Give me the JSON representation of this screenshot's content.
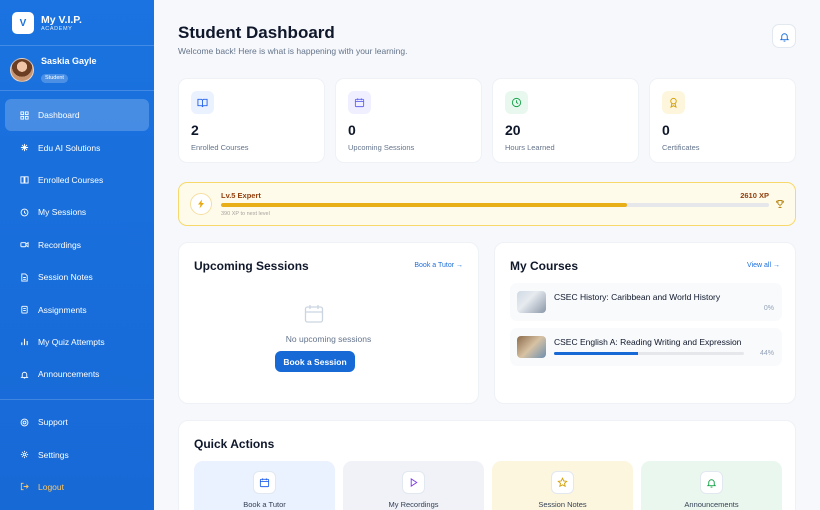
{
  "brand": {
    "logo_letter": "V",
    "name": "My V.I.P.",
    "sub": "ACADEMY"
  },
  "user": {
    "name": "Saskia Gayle",
    "role": "Student"
  },
  "nav": [
    {
      "label": "Dashboard",
      "icon": "grid-icon",
      "active": true
    },
    {
      "label": "Edu AI Solutions",
      "icon": "sparkle-icon"
    },
    {
      "label": "Enrolled Courses",
      "icon": "book-icon"
    },
    {
      "label": "My Sessions",
      "icon": "history-icon"
    },
    {
      "label": "Recordings",
      "icon": "video-icon"
    },
    {
      "label": "Session Notes",
      "icon": "file-icon"
    },
    {
      "label": "Assignments",
      "icon": "clipboard-icon"
    },
    {
      "label": "My Quiz Attempts",
      "icon": "bar-chart-icon"
    },
    {
      "label": "Announcements",
      "icon": "bell-icon"
    }
  ],
  "bottom_nav": [
    {
      "label": "Support",
      "icon": "lifebuoy-icon"
    },
    {
      "label": "Settings",
      "icon": "gear-icon"
    },
    {
      "label": "Logout",
      "icon": "logout-icon"
    }
  ],
  "header": {
    "title": "Student Dashboard",
    "subtitle": "Welcome back! Here is what is happening with your learning."
  },
  "stats": [
    {
      "value": "2",
      "label": "Enrolled Courses",
      "icon": "book-open-icon",
      "color": "#2563eb",
      "bg": "#eaf2ff"
    },
    {
      "value": "0",
      "label": "Upcoming Sessions",
      "icon": "calendar-icon",
      "color": "#6366f1",
      "bg": "#efefff"
    },
    {
      "value": "20",
      "label": "Hours Learned",
      "icon": "clock-icon",
      "color": "#16a34a",
      "bg": "#e8f8ee"
    },
    {
      "value": "0",
      "label": "Certificates",
      "icon": "award-icon",
      "color": "#d4a00a",
      "bg": "#fdf6dc"
    }
  ],
  "level": {
    "title": "Lv.5 Expert",
    "xp": "2610 XP",
    "next": "390 XP to next level",
    "progress_pct": 74
  },
  "upcoming": {
    "title": "Upcoming Sessions",
    "link": "Book a Tutor →",
    "empty": "No upcoming sessions",
    "button": "Book a Session"
  },
  "courses": {
    "title": "My Courses",
    "link": "View all →",
    "items": [
      {
        "title": "CSEC History: Caribbean and World History",
        "pct_label": "0%",
        "pct": 0
      },
      {
        "title": "CSEC English A: Reading Writing and Expression",
        "pct_label": "44%",
        "pct": 44
      }
    ]
  },
  "quick_actions": {
    "title": "Quick Actions",
    "items": [
      {
        "label": "Book a Tutor",
        "icon": "calendar-icon",
        "bg": "#eaf1ff",
        "color": "#2563eb"
      },
      {
        "label": "My Recordings",
        "icon": "play-icon",
        "bg": "#f1f2f8",
        "color": "#7c3aed"
      },
      {
        "label": "Session Notes",
        "icon": "star-icon",
        "bg": "#fdf6df",
        "color": "#d4a00a"
      },
      {
        "label": "Announcements",
        "icon": "bell-icon",
        "bg": "#eaf7ee",
        "color": "#16a34a"
      }
    ]
  }
}
